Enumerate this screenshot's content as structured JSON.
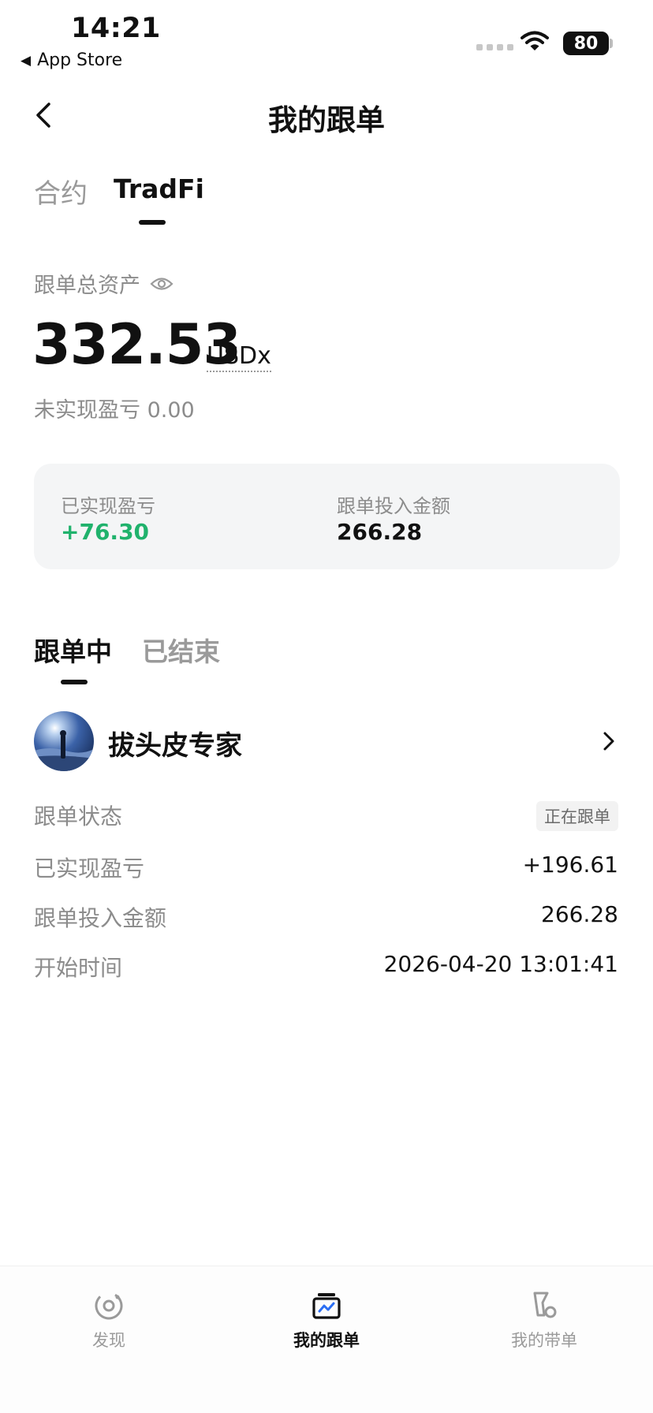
{
  "status_bar": {
    "time": "14:21",
    "back_app": "App Store",
    "battery": "80"
  },
  "header": {
    "title": "我的跟单"
  },
  "product_tabs": [
    {
      "label": "合约",
      "active": false
    },
    {
      "label": "TradFi",
      "active": true
    }
  ],
  "assets": {
    "label": "跟单总资产",
    "value": "332.53",
    "unit": "USDx",
    "unrealized": "未实现盈亏 0.00"
  },
  "summary": {
    "realized_label": "已实现盈亏",
    "realized_value": "+76.30",
    "invested_label": "跟单投入金额",
    "invested_value": "266.28"
  },
  "follow_tabs": [
    {
      "label": "跟单中",
      "active": true
    },
    {
      "label": "已结束",
      "active": false
    }
  ],
  "trader": {
    "name": "拔头皮专家",
    "rows": [
      {
        "label": "跟单状态",
        "value": "正在跟单"
      },
      {
        "label": "已实现盈亏",
        "value": "+196.61"
      },
      {
        "label": "跟单投入金额",
        "value": "266.28"
      },
      {
        "label": "开始时间",
        "value": "2026-04-20 13:01:41"
      }
    ]
  },
  "tabbar": [
    {
      "label": "发现",
      "icon": "discover-icon",
      "active": false
    },
    {
      "label": "我的跟单",
      "icon": "my-copy-icon",
      "active": true
    },
    {
      "label": "我的带单",
      "icon": "my-lead-icon",
      "active": false
    }
  ],
  "colors": {
    "profit_green": "#20b26c",
    "text_primary": "#111111",
    "text_secondary": "#8c8c8c",
    "card_bg": "#f4f5f6"
  }
}
